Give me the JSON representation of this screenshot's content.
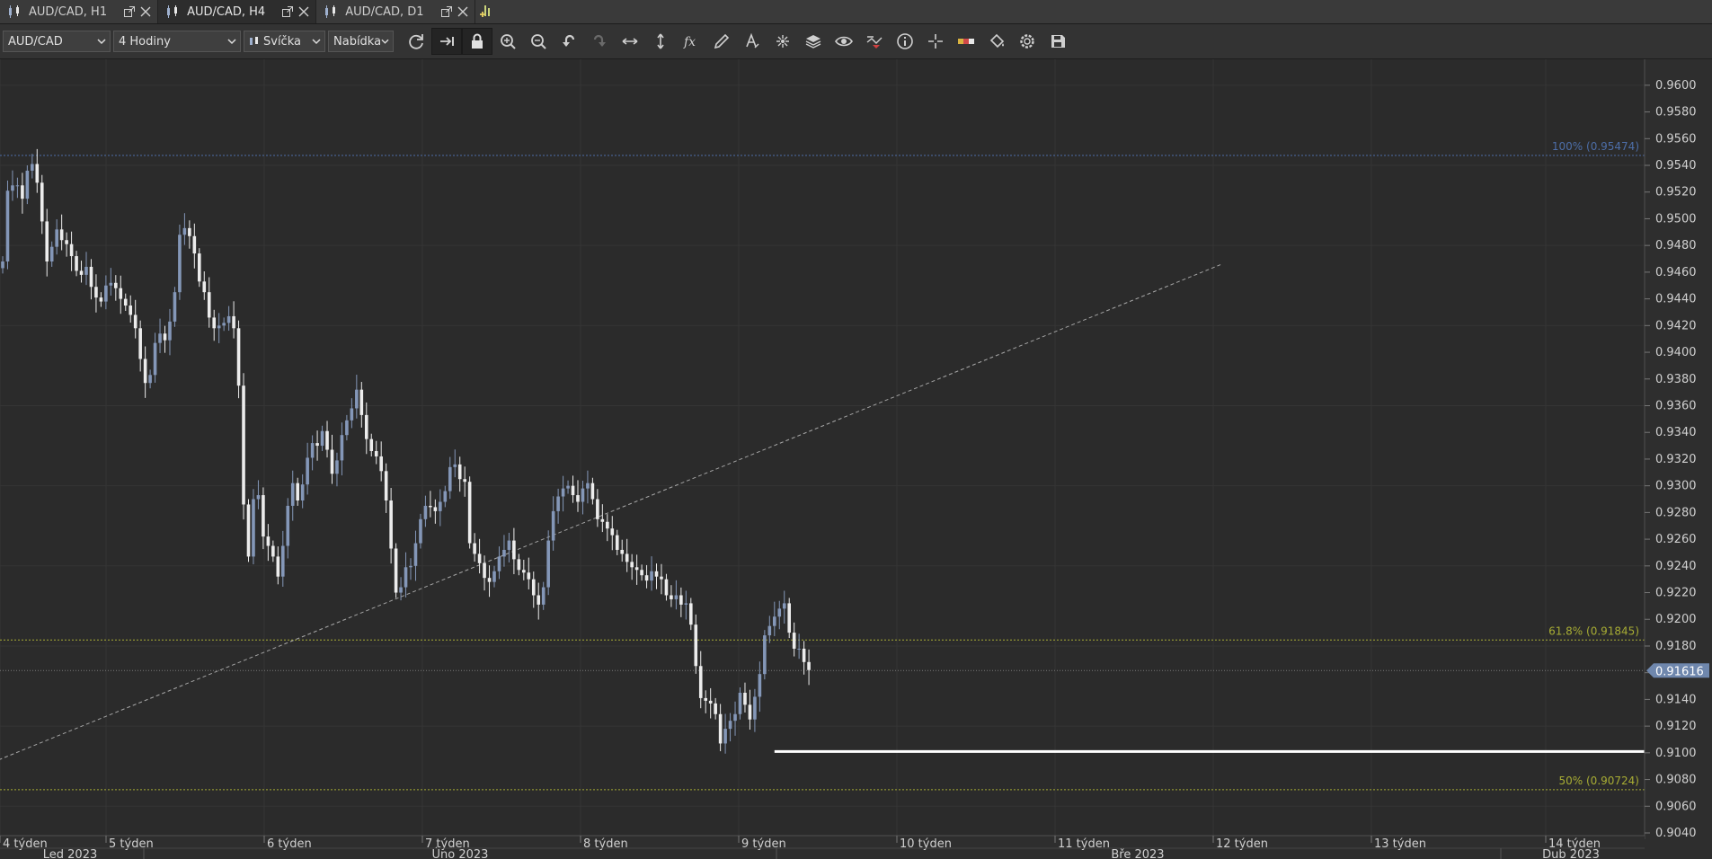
{
  "tabs": [
    {
      "label": "AUD/CAD, H1",
      "active": false
    },
    {
      "label": "AUD/CAD, H4",
      "active": true
    },
    {
      "label": "AUD/CAD, D1",
      "active": false
    }
  ],
  "toolbar": {
    "instrument": "AUD/CAD",
    "period": "4 Hodiny",
    "chart_type": "Svíčka",
    "price_type": "Nabídka"
  },
  "icons": {
    "tools": [
      "refresh-icon",
      "shift-chart-icon",
      "lock-icon",
      "zoom-in-icon",
      "zoom-out-icon",
      "undo-icon",
      "redo-icon",
      "fit-horizontal-icon",
      "fit-vertical-icon",
      "indicators-icon",
      "pencil-icon",
      "text-icon",
      "drawings-icon",
      "layers-icon",
      "eye-icon",
      "alerts-icon",
      "info-icon",
      "crosshair-icon",
      "ruler-icon",
      "fill-icon",
      "settings-icon",
      "save-icon"
    ]
  },
  "colors": {
    "background": "#2b2b2b",
    "bull_candle": "#8497b8",
    "bear_candle": "#ececec",
    "fib_100": "#4d6ea8",
    "fib_618": "#a7ac34",
    "fib_50": "#a7ac34",
    "current_price": "#6f87ad"
  },
  "chart_data": {
    "type": "candlestick",
    "instrument": "AUD/CAD",
    "timeframe": "H4",
    "ylim": [
      0.904,
      0.961
    ],
    "y_ticks": [
      "0.9600",
      "0.9580",
      "0.9560",
      "0.9540",
      "0.9520",
      "0.9500",
      "0.9480",
      "0.9460",
      "0.9440",
      "0.9420",
      "0.9400",
      "0.9380",
      "0.9360",
      "0.9340",
      "0.9320",
      "0.9300",
      "0.9280",
      "0.9260",
      "0.9240",
      "0.9220",
      "0.9200",
      "0.9180",
      "0.9160",
      "0.9140",
      "0.9120",
      "0.9100",
      "0.9080",
      "0.9060",
      "0.9040"
    ],
    "x_week_labels": [
      "4 týden",
      "5 týden",
      "6 týden",
      "7 týden",
      "8 týden",
      "9 týden",
      "10 týden",
      "11 týden",
      "12 týden",
      "13 týden",
      "14 týden"
    ],
    "x_month_labels": [
      "Led 2023",
      "Úno 2023",
      "Bře 2023",
      "Dub 2023"
    ],
    "fib_levels": [
      {
        "label": "100% (0.95474)",
        "value": 0.95474
      },
      {
        "label": "61.8% (0.91845)",
        "value": 0.91845
      },
      {
        "label": "50% (0.90724)",
        "value": 0.90724
      }
    ],
    "current_price": {
      "label": "0.91616",
      "value": 0.91616
    },
    "trendline": {
      "start": {
        "bar": -2,
        "price": 0.9093
      },
      "end": {
        "bar": 248,
        "price": 0.9466
      }
    },
    "horizontal_line": {
      "value": 0.9101,
      "from_bar": 157
    },
    "candles_close": [
      0.9468,
      0.9521,
      0.9525,
      0.9525,
      0.9515,
      0.9536,
      0.9541,
      0.9527,
      0.9498,
      0.9468,
      0.9479,
      0.9492,
      0.9484,
      0.9481,
      0.9472,
      0.9461,
      0.9458,
      0.9464,
      0.9449,
      0.9441,
      0.9438,
      0.945,
      0.9452,
      0.9448,
      0.944,
      0.9435,
      0.9428,
      0.9418,
      0.9395,
      0.9377,
      0.9383,
      0.9407,
      0.9414,
      0.9409,
      0.9423,
      0.9445,
      0.9488,
      0.9493,
      0.9487,
      0.9474,
      0.9453,
      0.9445,
      0.9426,
      0.9418,
      0.942,
      0.9422,
      0.9427,
      0.9418,
      0.9375,
      0.9286,
      0.9247,
      0.929,
      0.9293,
      0.9262,
      0.9255,
      0.9247,
      0.9232,
      0.9255,
      0.9285,
      0.9302,
      0.9289,
      0.9301,
      0.9321,
      0.9332,
      0.933,
      0.9341,
      0.9327,
      0.9309,
      0.9319,
      0.9338,
      0.9349,
      0.9358,
      0.9372,
      0.9353,
      0.9335,
      0.9326,
      0.9322,
      0.9311,
      0.9289,
      0.9253,
      0.922,
      0.9224,
      0.9239,
      0.924,
      0.9257,
      0.9275,
      0.9285,
      0.9284,
      0.9281,
      0.9288,
      0.9296,
      0.9314,
      0.9316,
      0.9305,
      0.9303,
      0.9257,
      0.9249,
      0.9242,
      0.9231,
      0.9228,
      0.9236,
      0.9247,
      0.9252,
      0.9259,
      0.9245,
      0.9237,
      0.9235,
      0.923,
      0.9218,
      0.9211,
      0.9224,
      0.9259,
      0.9281,
      0.9292,
      0.9298,
      0.93,
      0.9293,
      0.9288,
      0.9298,
      0.9302,
      0.929,
      0.9275,
      0.9273,
      0.9268,
      0.9263,
      0.9252,
      0.9249,
      0.9243,
      0.9239,
      0.9237,
      0.9233,
      0.9229,
      0.9236,
      0.9232,
      0.923,
      0.9218,
      0.9215,
      0.9218,
      0.9211,
      0.9212,
      0.9196,
      0.9165,
      0.9141,
      0.9139,
      0.9137,
      0.9129,
      0.9107,
      0.9118,
      0.9124,
      0.9129,
      0.9145,
      0.9136,
      0.9125,
      0.9142,
      0.9159,
      0.9188,
      0.9195,
      0.9202,
      0.9208,
      0.9212,
      0.919,
      0.9178,
      0.9178,
      0.9168,
      0.9162
    ],
    "candles_note": ""
  }
}
